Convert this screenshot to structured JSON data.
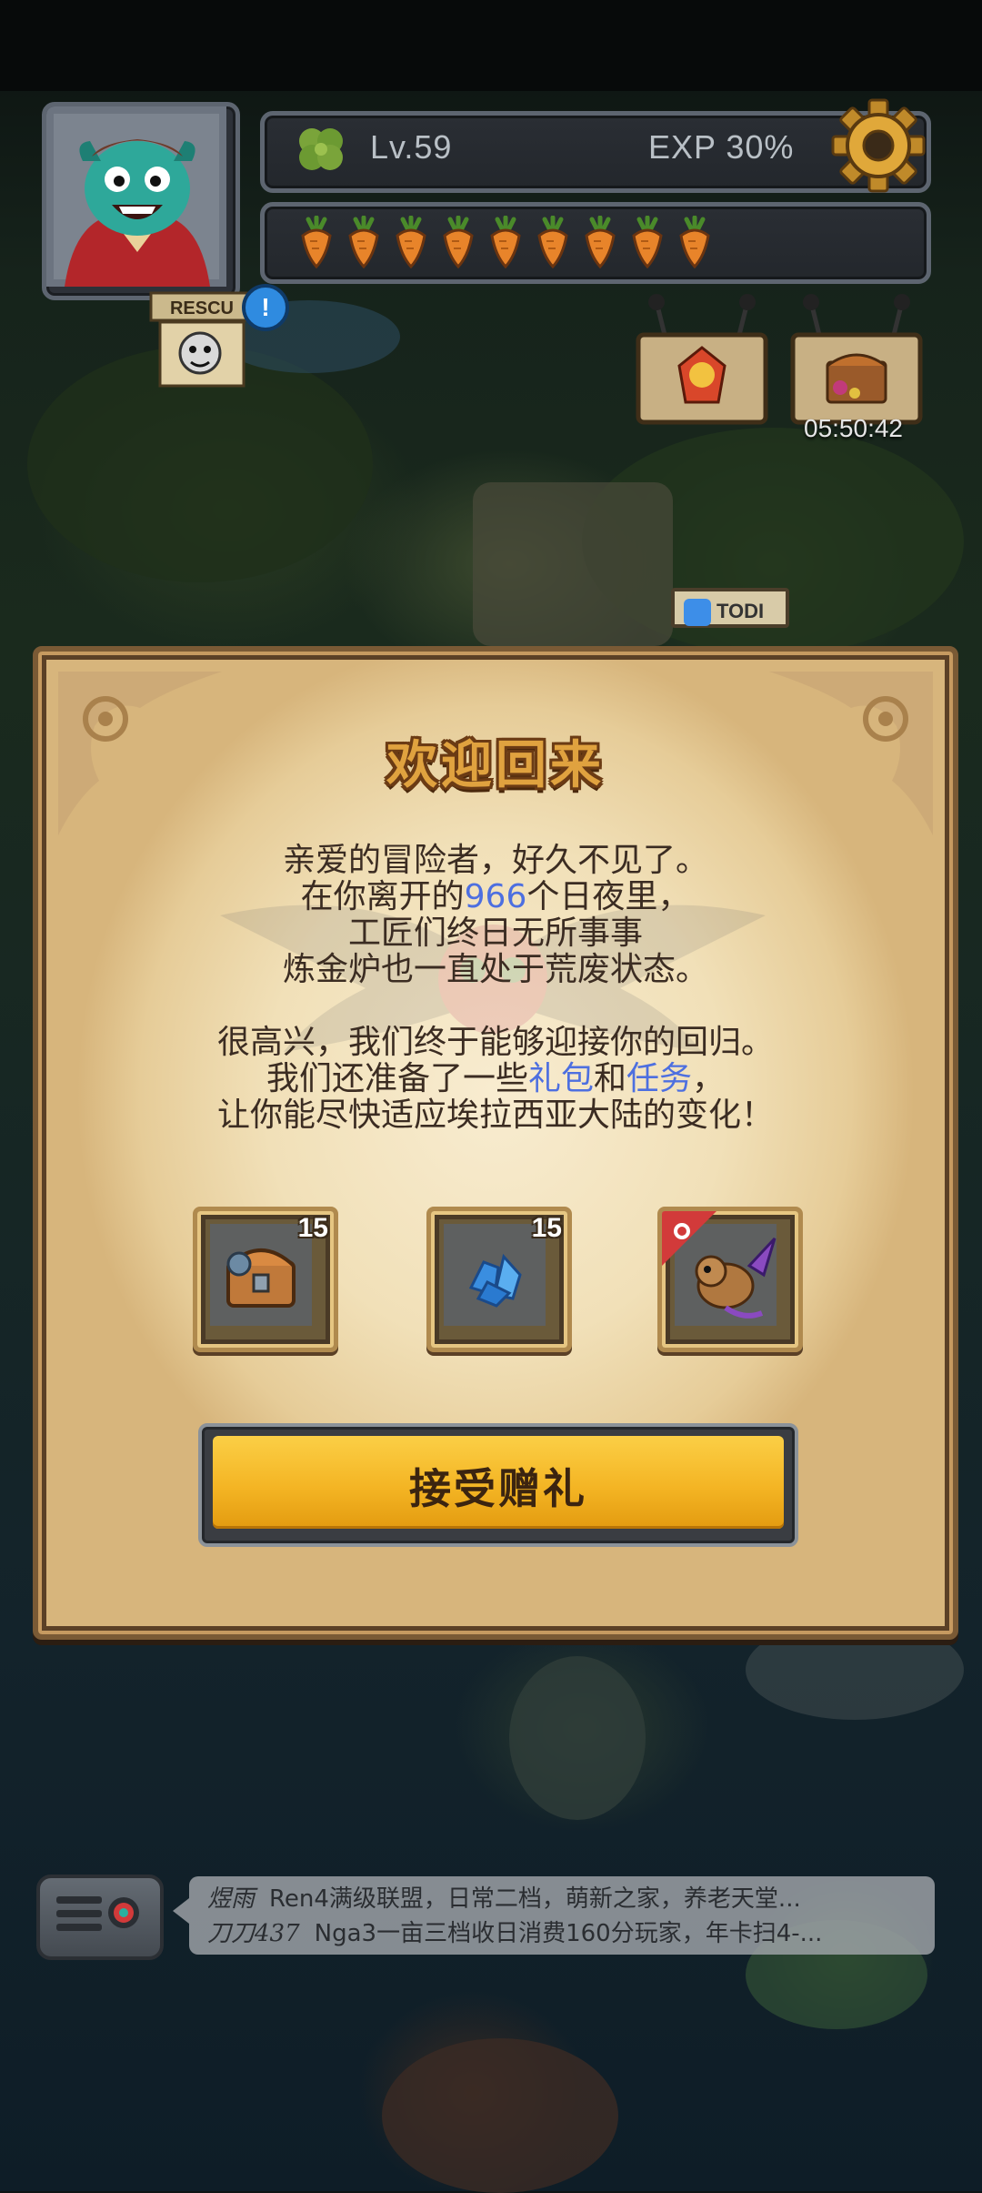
{
  "hud": {
    "level": "Lv.59",
    "exp": "EXP 30%",
    "carrot_count": 9,
    "timer": "05:50:42",
    "rescue_sign_label": "RESCU",
    "alert_badge": "!",
    "todi_label": "TODI"
  },
  "dialog": {
    "title": "欢迎回来",
    "paragraph1": {
      "line1": "亲爱的冒险者，好久不见了。",
      "line2_pre": "在你离开的",
      "line2_days": "966",
      "line2_post": "个日夜里，",
      "line3": "工匠们终日无所事事",
      "line4": "炼金炉也一直处于荒废状态。"
    },
    "paragraph2": {
      "line1": "很高兴，我们终于能够迎接你的回归。",
      "line2_pre": "我们还准备了一些",
      "line2_link1": "礼包",
      "line2_mid": "和",
      "line2_link2": "任务",
      "line2_post": "，",
      "line3": "让你能尽快适应埃拉西亚大陆的变化！"
    },
    "rewards": [
      {
        "icon": "treasure-chest-icon",
        "count": "15"
      },
      {
        "icon": "blue-crystal-icon",
        "count": "15"
      },
      {
        "icon": "dragon-pet-icon",
        "count": ""
      }
    ],
    "accept_button": "接受赠礼",
    "highlight_color": "#4d6fe0"
  },
  "chat": {
    "messages": [
      {
        "name": "煜雨",
        "text": "Ren4满级联盟，日常二档，萌新之家，养老天堂..."
      },
      {
        "name": "刀刀437",
        "text": "Nga3一亩三档收日消费160分玩家，年卡扫4-..."
      }
    ]
  }
}
